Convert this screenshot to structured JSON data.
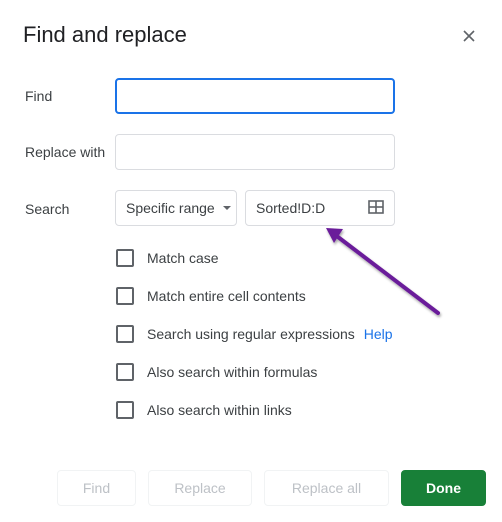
{
  "dialog": {
    "title": "Find and replace",
    "close_icon": "close-icon"
  },
  "find": {
    "label": "Find",
    "value": "",
    "placeholder": ""
  },
  "replace": {
    "label": "Replace with",
    "value": "",
    "placeholder": ""
  },
  "search": {
    "label": "Search",
    "scope_selected": "Specific range",
    "range_value": "Sorted!D:D",
    "range_icon": "grid-select-icon"
  },
  "options": [
    {
      "label": "Match case",
      "checked": false
    },
    {
      "label": "Match entire cell contents",
      "checked": false
    },
    {
      "label": "Search using regular expressions",
      "checked": false,
      "link": "Help"
    },
    {
      "label": "Also search within formulas",
      "checked": false
    },
    {
      "label": "Also search within links",
      "checked": false
    }
  ],
  "buttons": {
    "find": "Find",
    "replace": "Replace",
    "replace_all": "Replace all",
    "done": "Done"
  },
  "annotation": {
    "type": "arrow",
    "color": "#6a1b9a",
    "points_to": "range-input"
  },
  "colors": {
    "accent": "#1a73e8",
    "primary_button": "#188038",
    "disabled_text": "#bdc1c6"
  }
}
